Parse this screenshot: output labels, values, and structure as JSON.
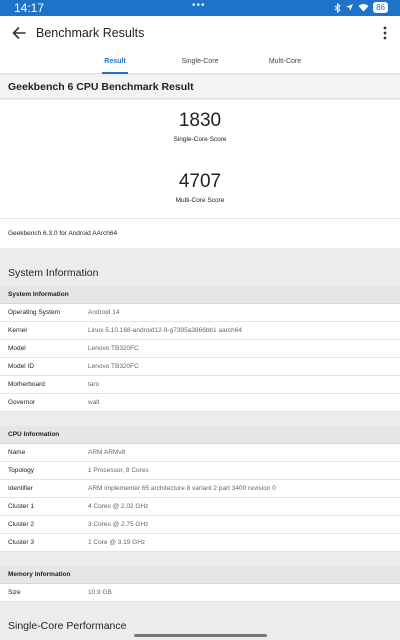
{
  "status_bar": {
    "time": "14:17",
    "battery": "86",
    "icons": [
      "bluetooth-icon",
      "location-icon",
      "wifi-icon",
      "battery-icon"
    ]
  },
  "app_bar": {
    "title": "Benchmark Results"
  },
  "tabs": [
    {
      "label": "Result",
      "active": true
    },
    {
      "label": "Single-Core",
      "active": false
    },
    {
      "label": "Multi-Core",
      "active": false
    }
  ],
  "result": {
    "heading": "Geekbench 6 CPU Benchmark Result",
    "single_core_score": "1830",
    "single_core_label": "Single-Core Score",
    "multi_core_score": "4707",
    "multi_core_label": "Multi-Core Score",
    "version_note": "Geekbench 6.3.0 for Android AArch64"
  },
  "system_information": {
    "title": "System Information",
    "tables": [
      {
        "header": "System Information",
        "rows": [
          {
            "key": "Operating System",
            "value": "Android 14"
          },
          {
            "key": "Kernel",
            "value": "Linux 5.10.168-android12-9-g7395a3866bb1 aarch64"
          },
          {
            "key": "Model",
            "value": "Lenovo TB320FC"
          },
          {
            "key": "Model ID",
            "value": "Lenovo TB320FC"
          },
          {
            "key": "Motherboard",
            "value": "taro"
          },
          {
            "key": "Governor",
            "value": "walt"
          }
        ]
      },
      {
        "header": "CPU Information",
        "rows": [
          {
            "key": "Name",
            "value": "ARM ARMv8"
          },
          {
            "key": "Topology",
            "value": "1 Processor, 8 Cores"
          },
          {
            "key": "Identifier",
            "value": "ARM implementer 65 architecture 8 variant 2 part 3400 revision 0"
          },
          {
            "key": "Cluster 1",
            "value": "4 Cores @ 2.02 GHz"
          },
          {
            "key": "Cluster 2",
            "value": "3 Cores @ 2.75 GHz"
          },
          {
            "key": "Cluster 3",
            "value": "1 Core @ 3.19 GHz"
          }
        ]
      },
      {
        "header": "Memory Information",
        "rows": [
          {
            "key": "Size",
            "value": "10.9 GB"
          }
        ]
      }
    ]
  },
  "next_section_title": "Single-Core Performance",
  "colors": {
    "accent": "#1e73c8"
  }
}
